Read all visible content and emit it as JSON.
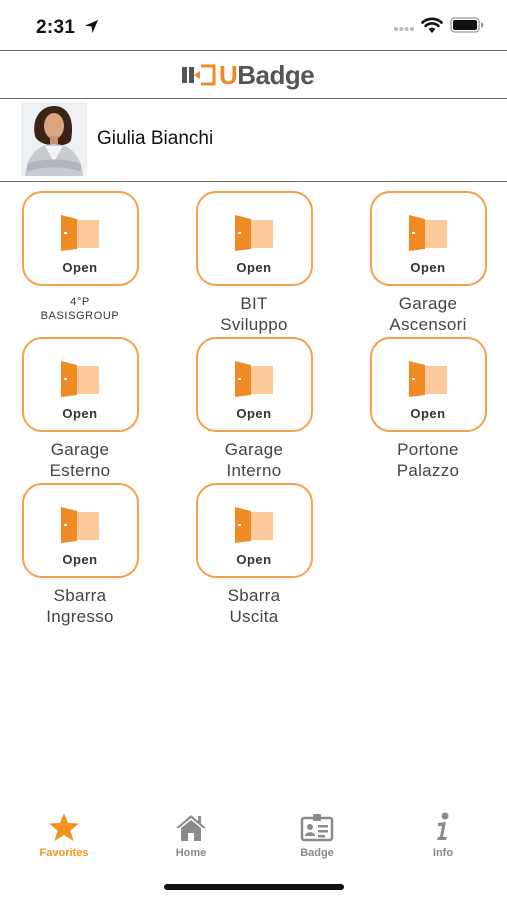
{
  "status_bar": {
    "time": "2:31",
    "location_icon": "location-arrow-icon",
    "wifi_icon": "wifi-icon",
    "battery_icon": "battery-icon"
  },
  "header": {
    "logo_u": "U",
    "logo_rest": "Badge"
  },
  "profile": {
    "name": "Giulia Bianchi"
  },
  "doors": [
    {
      "open_label": "Open",
      "name_line1": "4°P",
      "name_line2": "BASISGROUP",
      "small": true
    },
    {
      "open_label": "Open",
      "name_line1": "BIT",
      "name_line2": "Sviluppo"
    },
    {
      "open_label": "Open",
      "name_line1": "Garage",
      "name_line2": "Ascensori"
    },
    {
      "open_label": "Open",
      "name_line1": "Garage",
      "name_line2": "Esterno"
    },
    {
      "open_label": "Open",
      "name_line1": "Garage",
      "name_line2": "Interno"
    },
    {
      "open_label": "Open",
      "name_line1": "Portone",
      "name_line2": "Palazzo"
    },
    {
      "open_label": "Open",
      "name_line1": "Sbarra",
      "name_line2": "Ingresso"
    },
    {
      "open_label": "Open",
      "name_line1": "Sbarra",
      "name_line2": "Uscita"
    }
  ],
  "tabs": [
    {
      "label": "Favorites",
      "icon": "star-icon",
      "active": true
    },
    {
      "label": "Home",
      "icon": "home-icon",
      "active": false
    },
    {
      "label": "Badge",
      "icon": "badge-icon",
      "active": false
    },
    {
      "label": "Info",
      "icon": "info-icon",
      "active": false
    }
  ],
  "colors": {
    "accent": "#f08a24",
    "door_fill": "#f5a04a",
    "door_light": "#fbc99a",
    "tab_inactive": "#8a8a8a"
  }
}
